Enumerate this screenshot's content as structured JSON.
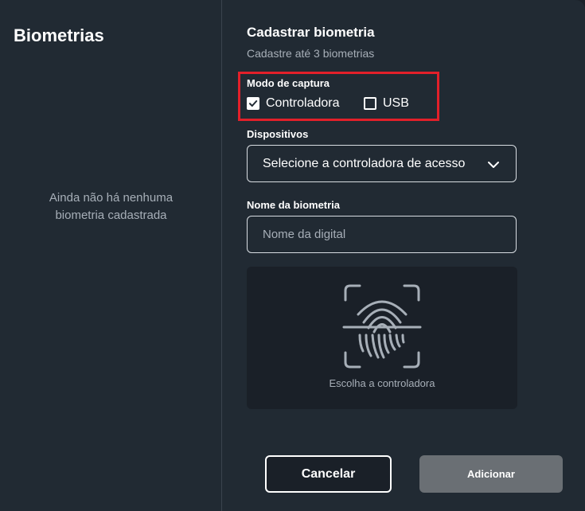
{
  "left_panel": {
    "title": "Biometrias",
    "empty_line1": "Ainda não há nenhuma",
    "empty_line2": "biometria cadastrada"
  },
  "form": {
    "title": "Cadastrar biometria",
    "subtitle": "Cadastre até 3 biometrias",
    "capture_mode": {
      "label": "Modo de captura",
      "options": [
        {
          "label": "Controladora",
          "checked": true
        },
        {
          "label": "USB",
          "checked": false
        }
      ]
    },
    "devices": {
      "label": "Dispositivos",
      "selected": "Selecione a controladora de acesso"
    },
    "biometry_name": {
      "label": "Nome da biometria",
      "placeholder": "Nome da digital",
      "value": ""
    },
    "capture_area": {
      "icon": "fingerprint-scan-icon",
      "hint": "Escolha a controladora"
    },
    "buttons": {
      "cancel": "Cancelar",
      "add": "Adicionar"
    }
  },
  "colors": {
    "background": "#212a33",
    "highlight_border": "#e3202a",
    "add_button_disabled": "#6a6f74",
    "muted_text": "#a7afb8"
  }
}
